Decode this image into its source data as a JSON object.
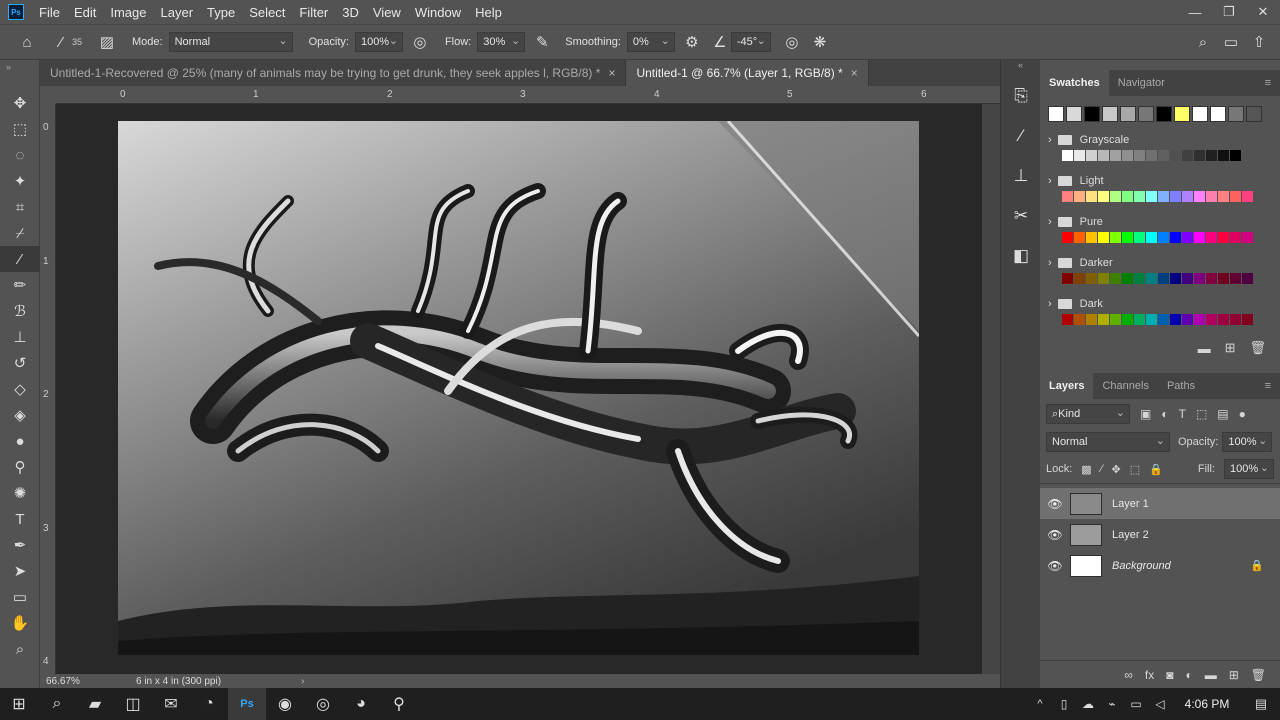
{
  "app": {
    "logo": "Ps",
    "menu": [
      "File",
      "Edit",
      "Image",
      "Layer",
      "Type",
      "Select",
      "Filter",
      "3D",
      "View",
      "Window",
      "Help"
    ],
    "window_controls": [
      "minimize-icon",
      "restore-icon",
      "close-icon"
    ]
  },
  "options": {
    "brush_size": "35",
    "mode_label": "Mode:",
    "mode_value": "Normal",
    "opacity_label": "Opacity:",
    "opacity_value": "100%",
    "flow_label": "Flow:",
    "flow_value": "30%",
    "smoothing_label": "Smoothing:",
    "smoothing_value": "0%",
    "angle_value": "-45°"
  },
  "tabs": [
    {
      "label": "Untitled-1-Recovered @ 25% (many of animals may be trying to  get drunk, they seek apples l, RGB/8) *",
      "active": false
    },
    {
      "label": "Untitled-1 @ 66.7% (Layer 1, RGB/8) *",
      "active": true
    }
  ],
  "ruler": {
    "top": [
      "0",
      "1",
      "2",
      "3",
      "4",
      "5",
      "6"
    ],
    "left": [
      "0",
      "1",
      "2",
      "3",
      "4"
    ]
  },
  "status": {
    "zoom": "66.67%",
    "doc_info": "6 in x 4 in (300 ppi)"
  },
  "swatches": {
    "tab_swatches": "Swatches",
    "tab_navigator": "Navigator",
    "recent": [
      "#ffffff",
      "#d9d9d9",
      "#000000",
      "#c8c8c8",
      "#a8a8a8",
      "#777777",
      "#000000",
      "#ffff66",
      "#ffffff",
      "#ffffff",
      "#777777",
      "#555555"
    ],
    "groups": [
      {
        "name": "Grayscale",
        "colors": [
          "#ffffff",
          "#e8e8e8",
          "#d0d0d0",
          "#b8b8b8",
          "#a0a0a0",
          "#909090",
          "#808080",
          "#707070",
          "#606060",
          "#505050",
          "#404040",
          "#303030",
          "#202020",
          "#101010",
          "#000000"
        ]
      },
      {
        "name": "Light",
        "colors": [
          "#ff8080",
          "#ffb080",
          "#ffe080",
          "#ffff80",
          "#b0ff80",
          "#80ff80",
          "#80ffb0",
          "#80ffff",
          "#80b0ff",
          "#8080ff",
          "#b080ff",
          "#ff80ff",
          "#ff80b0",
          "#ff8080",
          "#ff6060",
          "#ff4080"
        ]
      },
      {
        "name": "Pure",
        "colors": [
          "#ff0000",
          "#ff6000",
          "#ffc000",
          "#ffff00",
          "#80ff00",
          "#00ff00",
          "#00ff80",
          "#00ffff",
          "#0080ff",
          "#0000ff",
          "#8000ff",
          "#ff00ff",
          "#ff0080",
          "#ff0040",
          "#e00060",
          "#d00080"
        ]
      },
      {
        "name": "Darker",
        "colors": [
          "#800000",
          "#804000",
          "#806000",
          "#808000",
          "#408000",
          "#008000",
          "#008040",
          "#008080",
          "#004080",
          "#000080",
          "#400080",
          "#800080",
          "#800040",
          "#700020",
          "#600030",
          "#500040"
        ]
      },
      {
        "name": "Dark",
        "colors": [
          "#b00000",
          "#b05000",
          "#b08000",
          "#b0b000",
          "#60b000",
          "#00b000",
          "#00b060",
          "#00b0b0",
          "#0060b0",
          "#0000b0",
          "#6000b0",
          "#b000b0",
          "#b00060",
          "#a00040",
          "#900030",
          "#800020"
        ]
      }
    ]
  },
  "layers": {
    "tab_layers": "Layers",
    "tab_channels": "Channels",
    "tab_paths": "Paths",
    "kind_label": "Kind",
    "blend_mode": "Normal",
    "opacity_label": "Opacity:",
    "opacity_value": "100%",
    "lock_label": "Lock:",
    "fill_label": "Fill:",
    "fill_value": "100%",
    "items": [
      {
        "name": "Layer 1",
        "selected": true
      },
      {
        "name": "Layer 2",
        "selected": false
      },
      {
        "name": "Background",
        "selected": false
      }
    ]
  },
  "taskbar": {
    "time": "4:06 PM"
  }
}
